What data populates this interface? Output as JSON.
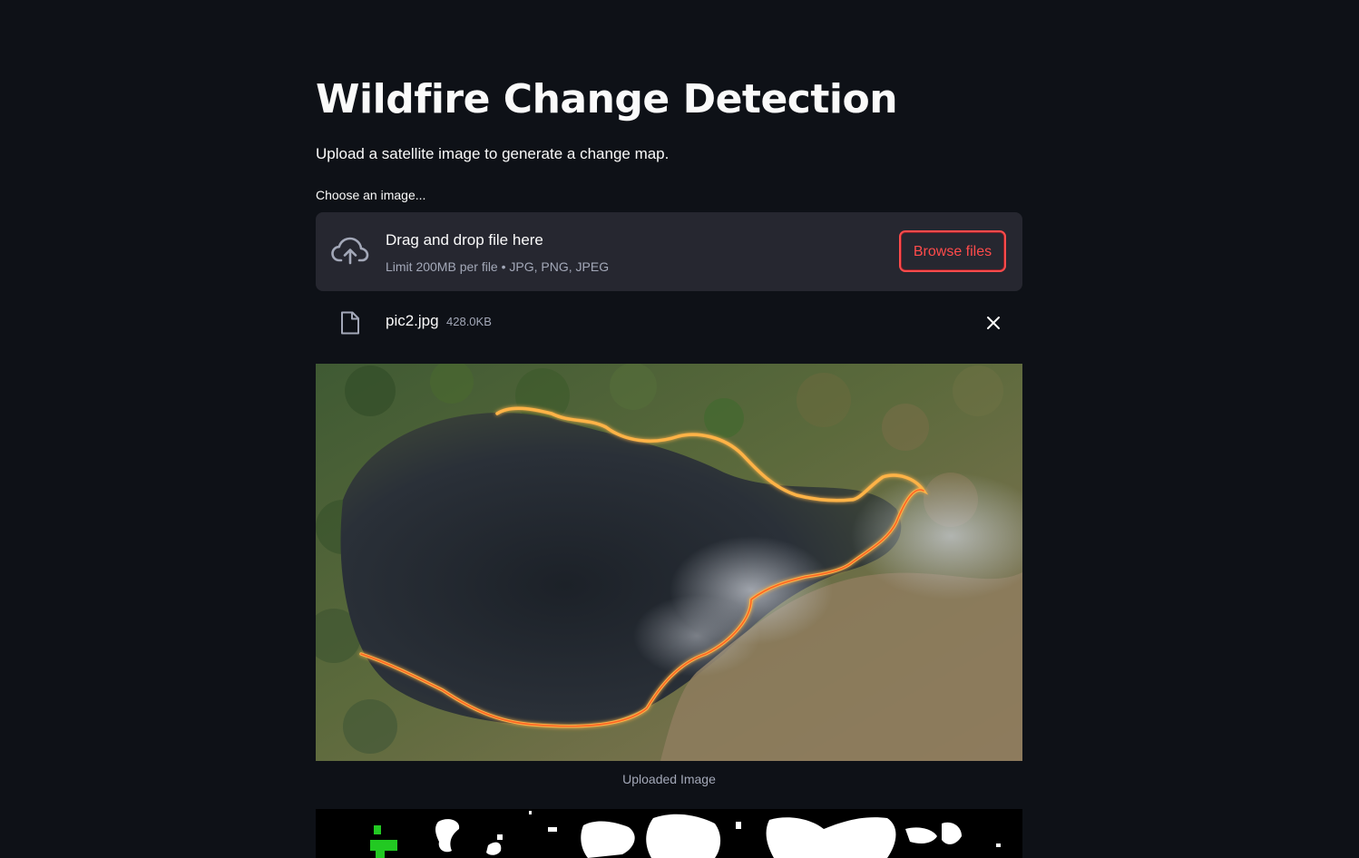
{
  "page": {
    "title": "Wildfire Change Detection",
    "subtitle": "Upload a satellite image to generate a change map."
  },
  "uploader": {
    "label": "Choose an image...",
    "drop_title": "Drag and drop file here",
    "limit_text": "Limit 200MB per file • JPG, PNG, JPEG",
    "browse_label": "Browse files",
    "icon": "cloud-upload-icon"
  },
  "uploaded_file": {
    "name": "pic2.jpg",
    "size": "428.0KB",
    "icon": "file-icon",
    "remove_icon": "close-icon"
  },
  "uploaded_image": {
    "caption": "Uploaded Image"
  },
  "colors": {
    "background": "#0e1117",
    "panel": "#262730",
    "accent": "#ff4b4b",
    "text": "#fafafa",
    "muted_text": "#a3a8b8"
  }
}
